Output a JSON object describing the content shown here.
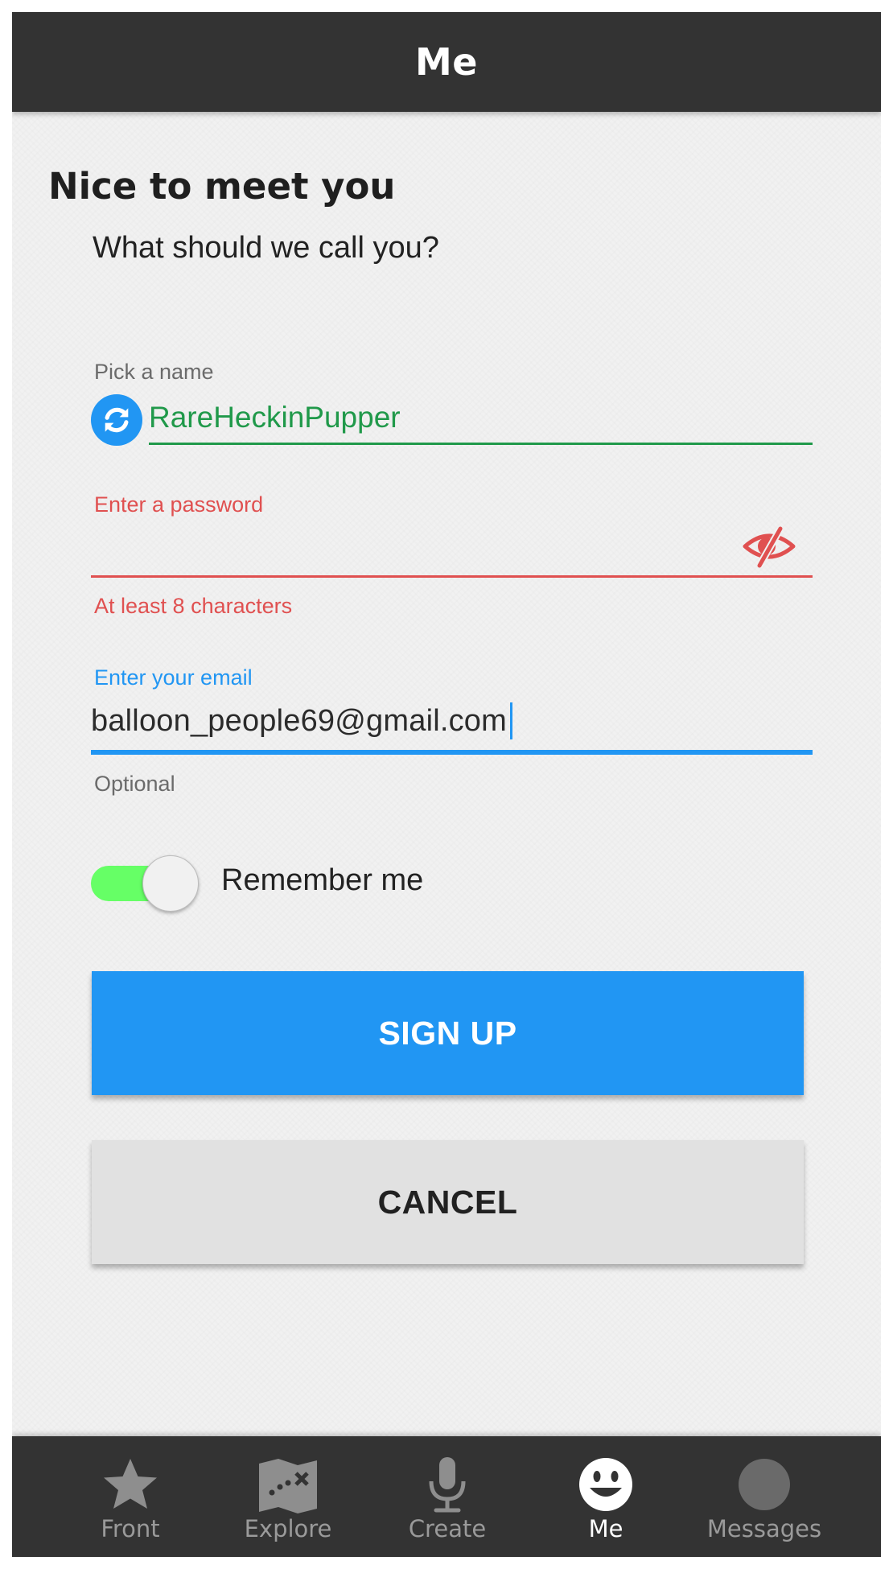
{
  "header": {
    "title": "Me"
  },
  "page": {
    "heading": "Nice to meet you",
    "subheading": "What should we call you?"
  },
  "form": {
    "name": {
      "label": "Pick a name",
      "value": "RareHeckinPupper",
      "refresh_icon": "refresh-icon"
    },
    "password": {
      "label": "Enter a password",
      "value": "",
      "helper": "At least 8 characters",
      "toggle_icon": "eye-slash-icon"
    },
    "email": {
      "label": "Enter your email",
      "value": "balloon_people69@gmail.com",
      "helper": "Optional"
    },
    "remember": {
      "label": "Remember me",
      "checked": true
    },
    "signup_label": "SIGN UP",
    "cancel_label": "CANCEL"
  },
  "nav": {
    "items": [
      {
        "label": "Front",
        "icon": "star-icon",
        "active": false
      },
      {
        "label": "Explore",
        "icon": "map-icon",
        "active": false
      },
      {
        "label": "Create",
        "icon": "microphone-icon",
        "active": false
      },
      {
        "label": "Me",
        "icon": "smiley-icon",
        "active": true
      },
      {
        "label": "Messages",
        "icon": "messages-icon",
        "active": false
      }
    ]
  },
  "colors": {
    "topbar": "#333333",
    "accent_blue": "#2196f3",
    "valid_green": "#20994a",
    "error_red": "#e05050",
    "toggle_on": "#66ff66",
    "cancel_gray": "#e1e1e1"
  }
}
